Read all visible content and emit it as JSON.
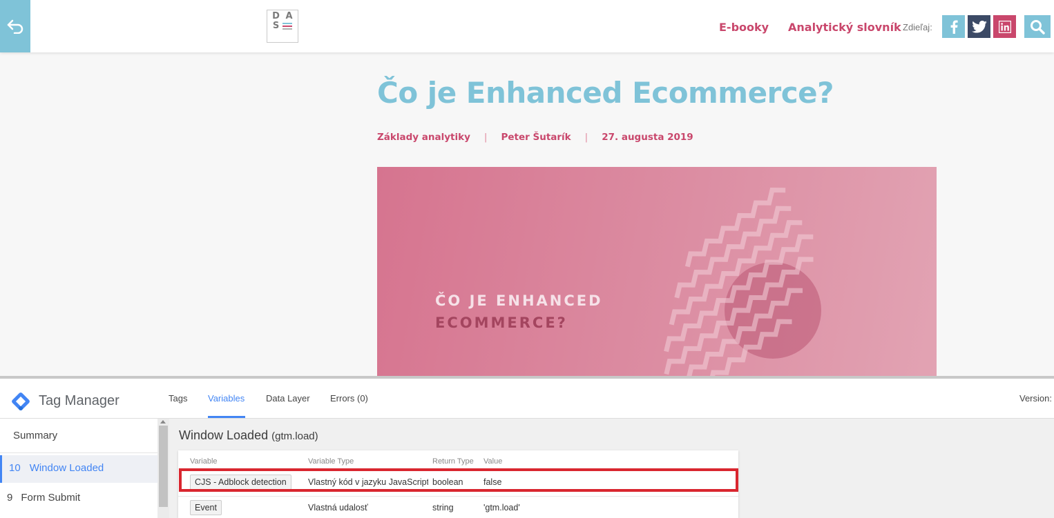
{
  "header": {
    "logo_letters": [
      "D",
      "A",
      "S"
    ],
    "nav": [
      "E-booky",
      "Analytický slovník"
    ],
    "share_label": "Zdieľaj:",
    "social_icons": [
      "facebook-icon",
      "twitter-icon",
      "linkedin-icon"
    ],
    "colors": {
      "accent_blue": "#7fc3d8",
      "accent_pink": "#c9476c",
      "twitter": "#3c4a66",
      "linkedin": "#c9476c"
    }
  },
  "article": {
    "title": "Čo je Enhanced Ecommerce?",
    "category": "Základy analytiky",
    "author": "Peter Šutarík",
    "date": "27. augusta 2019",
    "separator": "|",
    "hero_line1": "ČO JE ENHANCED",
    "hero_line2": "ECOMMERCE?"
  },
  "gtm": {
    "app_name": "Tag Manager",
    "tabs": [
      "Tags",
      "Variables",
      "Data Layer",
      "Errors (0)"
    ],
    "active_tab": "Variables",
    "version_label": "Version:",
    "sidebar": {
      "summary": "Summary",
      "events": [
        {
          "num": "10",
          "label": "Window Loaded",
          "active": true
        },
        {
          "num": "9",
          "label": "Form Submit",
          "active": false
        }
      ]
    },
    "event_title": "Window Loaded",
    "event_sub": "(gtm.load)",
    "columns": [
      "Variable",
      "Variable Type",
      "Return Type",
      "Value"
    ],
    "rows": [
      {
        "variable": "CJS - Adblock detection",
        "type": "Vlastný kód v jazyku JavaScript",
        "return": "boolean",
        "value": "false",
        "highlighted": true
      },
      {
        "variable": "Event",
        "type": "Vlastná udalosť",
        "return": "string",
        "value": "'gtm.load'",
        "highlighted": false
      }
    ]
  }
}
